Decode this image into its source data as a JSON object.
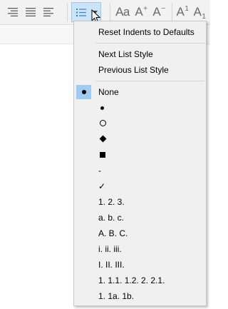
{
  "menu": {
    "reset_label": "Reset Indents to Defaults",
    "next_label": "Next List Style",
    "previous_label": "Previous List Style",
    "none_label": "None",
    "dash_label": "-",
    "check_label": "✓",
    "numbered_labels": [
      "1. 2. 3.",
      "a. b. c.",
      "A. B. C.",
      "i. ii. iii.",
      "I. II. III.",
      "1. 1.1. 1.2. 2. 2.1.",
      "1. 1a. 1b."
    ],
    "bullet_icons": [
      "filled-circle-bullet-icon",
      "hollow-circle-bullet-icon",
      "diamond-bullet-icon",
      "square-bullet-icon"
    ],
    "selected": "None"
  },
  "toolbar": {
    "font_size_label": "Aa",
    "grow_label": "A",
    "grow_mark": "+",
    "shrink_label": "A",
    "shrink_mark": "−",
    "superscript_label": "A",
    "superscript_mark": "1",
    "subscript_label": "A",
    "subscript_mark": "1",
    "selected_accent": "#cce4f7",
    "menu_highlight": "#a0cbf0"
  }
}
